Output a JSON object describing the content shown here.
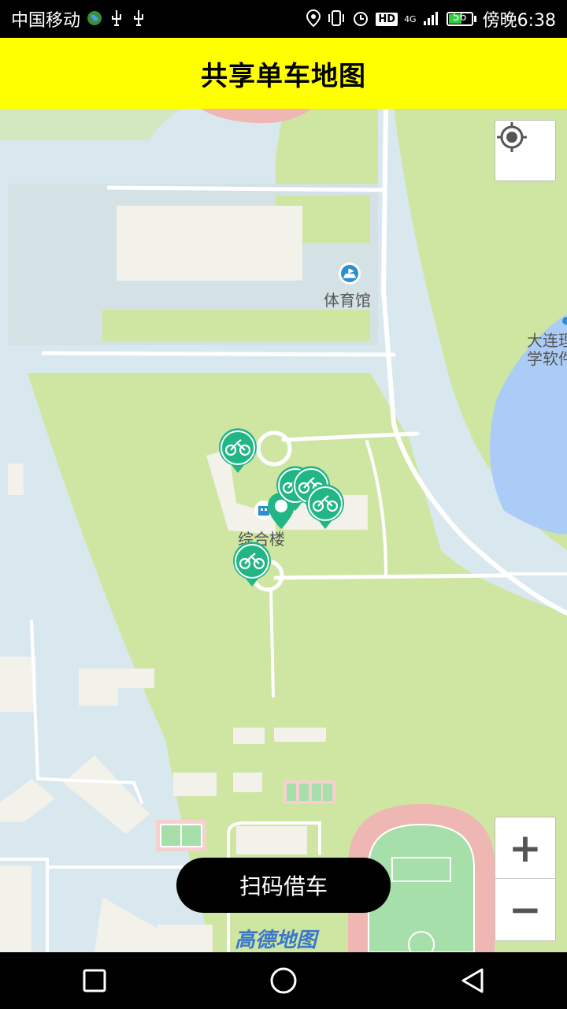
{
  "status_bar": {
    "carrier": "中国移动",
    "network_badge": "4G",
    "hd_badge": "HD",
    "battery_level": "56",
    "time": "傍晚6:38"
  },
  "header": {
    "title": "共享单车地图"
  },
  "map": {
    "poi_labels": {
      "gym": "体育馆",
      "complex": "综合楼",
      "university_line1": "大连理",
      "university_line2": "学软件"
    },
    "logo": "高德地图",
    "colors": {
      "green": "#cfe6a3",
      "road": "#ffffff",
      "building": "#f2f1ea",
      "water": "#abccf7",
      "track": "#eeb7b4",
      "field": "#a7dfaa",
      "marker": "#22b585"
    }
  },
  "controls": {
    "zoom_in": "+",
    "zoom_out": "−"
  },
  "actions": {
    "scan_button": "扫码借车"
  }
}
